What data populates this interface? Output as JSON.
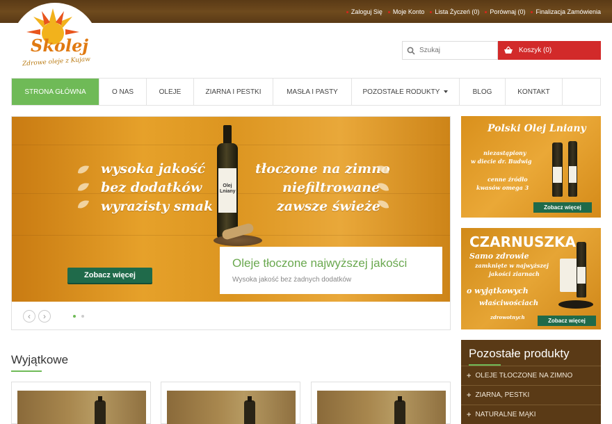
{
  "topbar": {
    "links": [
      "Zaloguj Się",
      "Moje Konto",
      "Lista Życzeń (0)",
      "Porównaj (0)",
      "Finalizacja Zamówienia"
    ]
  },
  "logo": {
    "brand": "Skolej",
    "tagline": "Zdrowe oleje z Kujaw"
  },
  "search": {
    "placeholder": "Szukaj"
  },
  "cart": {
    "label": "Koszyk (0)"
  },
  "nav": {
    "items": [
      "Strona Główna",
      "O nas",
      "Oleje",
      "Ziarna i pestki",
      "Masła i pasty",
      "Pozostałe rodukty",
      "Blog",
      "Kontakt"
    ]
  },
  "slider": {
    "left_phrases": [
      "wysoka jakość",
      "bez dodatków",
      "wyrazisty smak"
    ],
    "right_phrases": [
      "tłoczone na zimno",
      "niefiltrowane",
      "zawsze świeże"
    ],
    "bottle_label": "Olej Lniany",
    "cta": "Zobacz więcej",
    "caption_title": "Oleje tłoczone najwyższej jakości",
    "caption_sub": "Wysoka jakość bez żadnych dodatków",
    "pages": 2,
    "active_page": 1
  },
  "banner1": {
    "title": "Polski Olej Lniany",
    "line1": "niezastąpiony",
    "line2": "w diecie dr. Budwig",
    "line3": "cenne źródło",
    "line4": "kwasów omega 3",
    "button": "Zobacz więcej"
  },
  "banner2": {
    "title": "CZARNUSZKA",
    "lines": [
      "Samo zdrowie",
      "zamknięte w najwyższej",
      "jakości ziarnach",
      "o wyjątkowych",
      "właściwościach",
      "zdrowotnych"
    ],
    "button": "Zobacz więcej"
  },
  "sidebar": {
    "title": "Pozostałe produkty",
    "items": [
      "Oleje tłoczone na zimno",
      "Ziarna, pestki",
      "Naturalne mąki"
    ]
  },
  "featured": {
    "title": "Wyjątkowe",
    "cards": 3
  },
  "colors": {
    "brown": "#5a3a16",
    "green": "#6fba57",
    "red": "#d22a2a",
    "dark_green": "#1f6a4a"
  }
}
